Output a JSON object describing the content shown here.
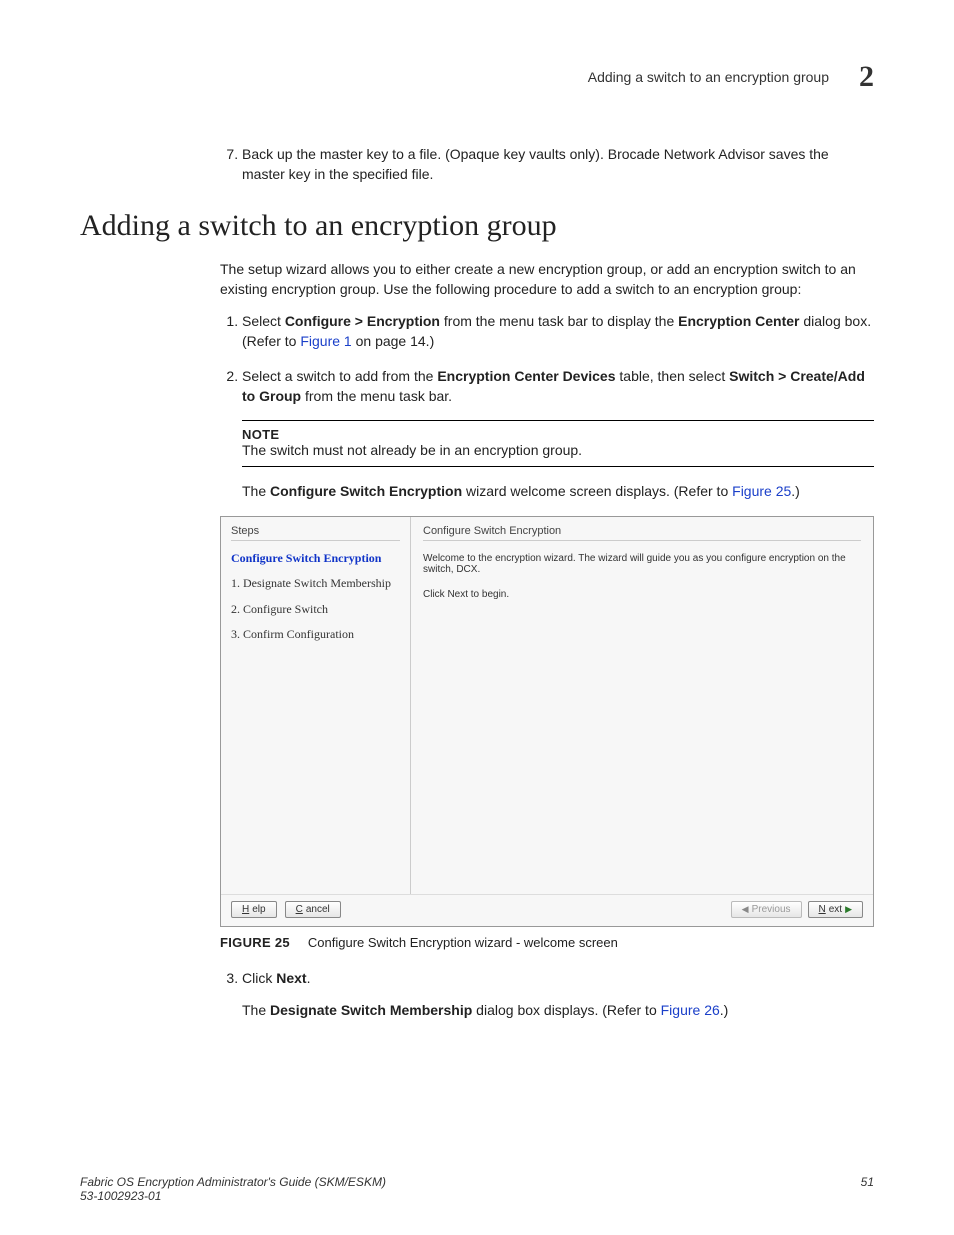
{
  "header": {
    "runningTitle": "Adding a switch to an encryption group",
    "chapterNumber": "2"
  },
  "step7": {
    "number": "7.",
    "text_a": "Back up the master key to a file. (Opaque key vaults only). Brocade Network Advisor saves the master key in the specified file."
  },
  "heading": "Adding a switch to an encryption group",
  "intro": "The setup wizard allows you to either create a new encryption group, or add an encryption switch to an existing encryption group. Use the following procedure to add a switch to an encryption group:",
  "ol1": {
    "li1_a": "Select ",
    "li1_b": "Configure > Encryption",
    "li1_c": " from the menu task bar to display the ",
    "li1_d": "Encryption Center",
    "li1_e": " dialog box. (Refer to ",
    "li1_link": "Figure 1",
    "li1_f": " on page 14.)",
    "li2_a": "Select a switch to add from the ",
    "li2_b": "Encryption Center Devices",
    "li2_c": " table, then select ",
    "li2_d": "Switch > Create/Add to Group",
    "li2_e": " from the menu task bar."
  },
  "note": {
    "label": "NOTE",
    "text": "The switch must not already be in an encryption group."
  },
  "postNote_a": "The ",
  "postNote_b": "Configure Switch Encryption",
  "postNote_c": " wizard welcome screen displays. (Refer to ",
  "postNote_link": "Figure 25",
  "postNote_d": ".)",
  "wizard": {
    "stepsHeader": "Steps",
    "step0": "Configure Switch Encryption",
    "step1": "1. Designate Switch Membership",
    "step2": "2. Configure Switch",
    "step3": "3. Confirm Configuration",
    "mainTitle": "Configure Switch Encryption",
    "welcome": "Welcome to the encryption wizard. The wizard will guide you as you configure encryption on the switch, DCX.",
    "clickNext": "Click Next to begin.",
    "buttons": {
      "help": "Help",
      "cancel": "Cancel",
      "previous": "Previous",
      "next": "Next"
    }
  },
  "figure": {
    "label": "FIGURE 25",
    "caption": "Configure Switch Encryption wizard - welcome screen"
  },
  "ol2": {
    "li3_a": "Click ",
    "li3_b": "Next",
    "li3_c": ".",
    "li3_post_a": "The ",
    "li3_post_b": "Designate Switch Membership",
    "li3_post_c": " dialog box displays. (Refer to ",
    "li3_post_link": "Figure 26",
    "li3_post_d": ".)"
  },
  "footer": {
    "leftLine1": "Fabric OS Encryption Administrator's Guide (SKM/ESKM)",
    "leftLine2": "53-1002923-01",
    "pageNum": "51"
  }
}
